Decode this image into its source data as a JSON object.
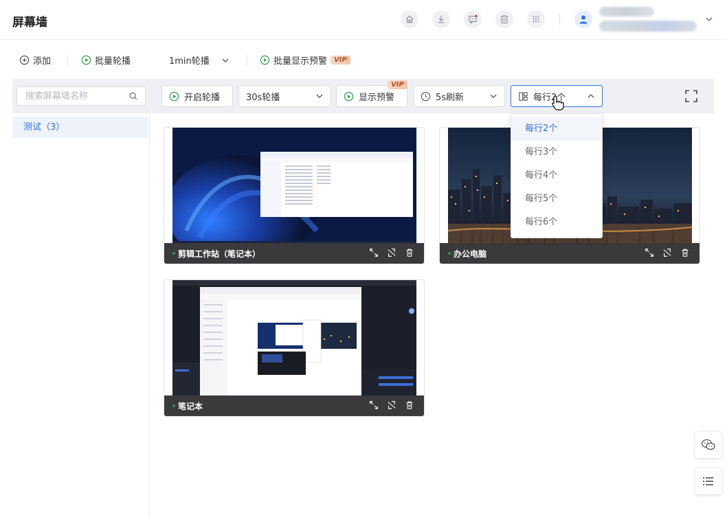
{
  "header": {
    "title": "屏幕墙",
    "icons": [
      "home-icon",
      "download-icon",
      "message-icon",
      "clipboard-icon",
      "apps-icon"
    ],
    "avatar_icon": "user-avatar-icon"
  },
  "toolbar1": {
    "add_label": "添加",
    "batch_rotate_label": "批量轮播",
    "rotate_interval": "1min轮播",
    "batch_alert_label": "批量显示预警",
    "vip": "VIP"
  },
  "toolbar2": {
    "search_placeholder": "搜索屏幕墙名称",
    "start_rotate_label": "开启轮播",
    "rotate_select": "30s轮播",
    "show_alert_label": "显示预警",
    "vip": "VIP",
    "refresh_select": "5s刷新",
    "per_row_select": "每行2个"
  },
  "sidebar": {
    "items": [
      {
        "label": "测试（3）"
      }
    ]
  },
  "cards": [
    {
      "name": "剪辑工作站（笔记本）"
    },
    {
      "name": "办公电脑"
    },
    {
      "name": "笔记本"
    }
  ],
  "per_row_dropdown": {
    "options": [
      "每行2个",
      "每行3个",
      "每行4个",
      "每行5个",
      "每行6个"
    ],
    "selected": "每行2个"
  },
  "colors": {
    "accent": "#2d6fe0",
    "card_bar": "#3a3a3c",
    "vip_text": "#b4542a",
    "play_icon": "#2f9a4a"
  }
}
